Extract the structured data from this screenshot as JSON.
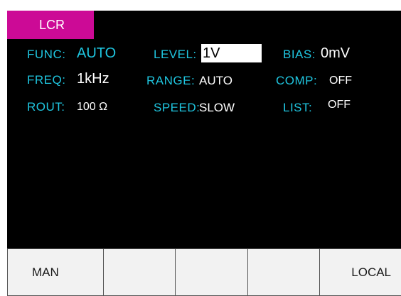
{
  "mode_tab": "LCR",
  "colors": {
    "background": "#000000",
    "accent_tab": "#cc0a96",
    "label": "#1fc6e0",
    "value": "#ffffff"
  },
  "params": {
    "func": {
      "label": "FUNC:",
      "value": "AUTO"
    },
    "freq": {
      "label": "FREQ:",
      "value": "1kHz"
    },
    "rout": {
      "label": "ROUT:",
      "value": "100 Ω"
    },
    "level": {
      "label": "LEVEL:",
      "value": "1V"
    },
    "range": {
      "label": "RANGE:",
      "value": "AUTO"
    },
    "speed": {
      "label": "SPEED:",
      "value": "SLOW"
    },
    "bias": {
      "label": "BIAS:",
      "value": "0mV"
    },
    "comp": {
      "label": "COMP:",
      "value": "OFF"
    },
    "list": {
      "label": "LIST:",
      "value": "OFF"
    }
  },
  "softkeys": [
    "MAN",
    "",
    "",
    "",
    "LOCAL"
  ]
}
